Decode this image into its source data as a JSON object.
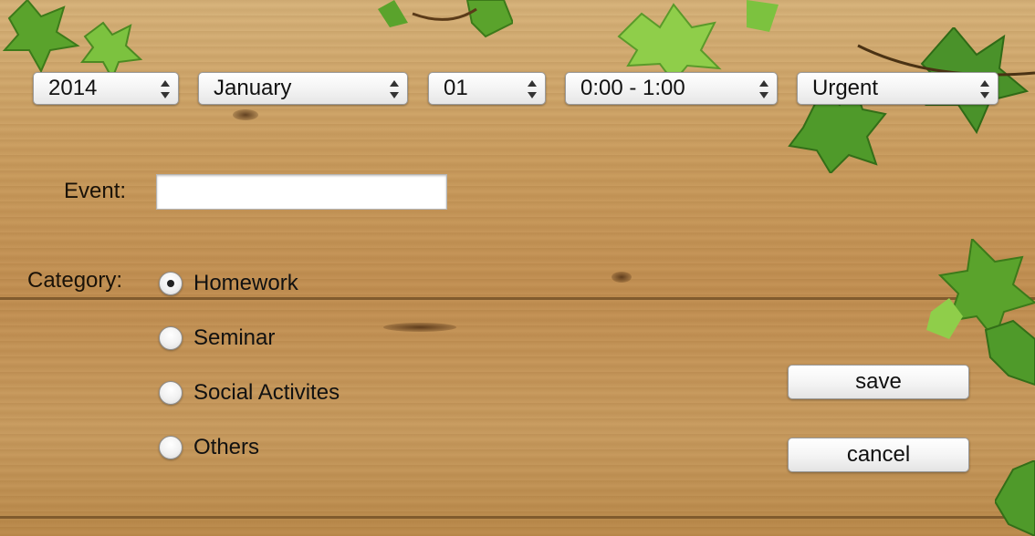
{
  "selectors": {
    "year": "2014",
    "month": "January",
    "day": "01",
    "time": "0:00 - 1:00",
    "priority": "Urgent"
  },
  "event": {
    "label": "Event:",
    "value": ""
  },
  "category": {
    "label": "Category:",
    "options": [
      "Homework",
      "Seminar",
      "Social Activites",
      "Others"
    ],
    "selected": "Homework"
  },
  "buttons": {
    "save": "save",
    "cancel": "cancel"
  },
  "colors": {
    "wood": "#c89a5c",
    "leaf": "#4f9a2a"
  }
}
